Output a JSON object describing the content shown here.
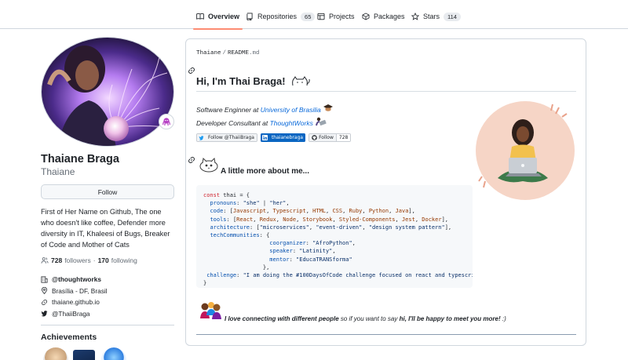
{
  "tabs": [
    {
      "label": "Overview",
      "count": null,
      "icon": "book-icon",
      "selected": true
    },
    {
      "label": "Repositories",
      "count": "65",
      "icon": "repo-icon",
      "selected": false
    },
    {
      "label": "Projects",
      "count": null,
      "icon": "table-icon",
      "selected": false
    },
    {
      "label": "Packages",
      "count": null,
      "icon": "package-icon",
      "selected": false
    },
    {
      "label": "Stars",
      "count": "114",
      "icon": "star-icon",
      "selected": false
    }
  ],
  "profile": {
    "full_name": "Thaiane Braga",
    "username": "Thaiane",
    "follow_label": "Follow",
    "bio": "First of Her Name on Github, The one who doesn't like coffee, Defender more diversity in IT, Khaleesi of Bugs, Breaker of Code and Mother of Cats",
    "followers_count": "728",
    "followers_label": "followers",
    "dot": "·",
    "following_count": "170",
    "following_label": "following",
    "organization": "@thoughtworks",
    "location": "Brasília - DF, Brasil",
    "website": "thaiane.github.io",
    "twitter": "@ThaiiBraga",
    "achievements_title": "Achievements"
  },
  "readme": {
    "owner": "Thaiane",
    "sep": "/",
    "file": "README",
    "ext": ".md",
    "heading": "Hi, I'm Thai Braga!",
    "role1_prefix": "Software Enginner at ",
    "role1_link": "University of Brasilia",
    "role2_prefix": "Developer Consultant at ",
    "role2_link": "ThoughtWorks",
    "shields": {
      "twitter_label": "Follow @ThaiiBraga",
      "linkedin_label": "thaianebraga",
      "github_label": "Follow",
      "github_count": "728"
    },
    "subheading": "A little more about me...",
    "closing_bold": "I love connecting with different people",
    "closing_mid": " so if you want to say ",
    "closing_bold2": "hi, I'll be happy to meet you more!",
    "closing_end": " :)"
  },
  "colors": {
    "accent": "#fd8c73",
    "link": "#0969da",
    "border": "#d0d7de",
    "muted": "#656d76",
    "linkedin": "#0a66c2"
  }
}
